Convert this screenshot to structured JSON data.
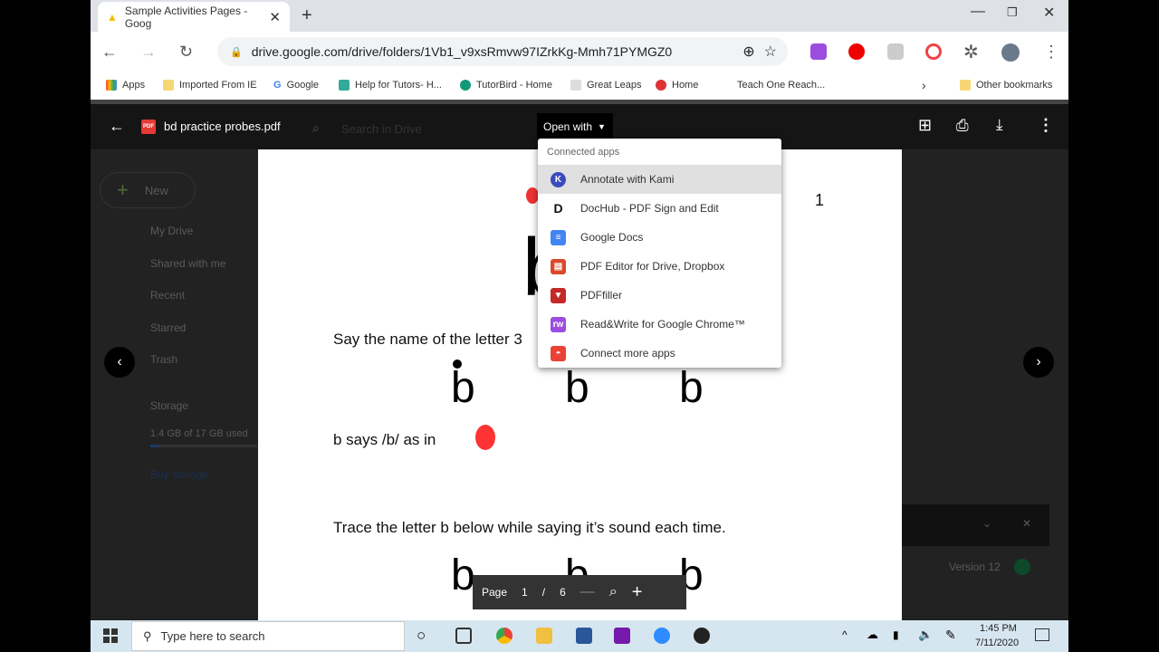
{
  "browser": {
    "tab_title": "Sample Activities Pages - Goog",
    "url": "drive.google.com/drive/folders/1Vb1_v9xsRmvw97IZrkKg-Mmh71PYMGZ0"
  },
  "bookmarks": [
    "Apps",
    "Imported From IE",
    "Google",
    "Help for Tutors- H...",
    "TutorBird - Home",
    "Great Leaps",
    "Home",
    "Teach One Reach...",
    "Other bookmarks"
  ],
  "drive": {
    "new_label": "New",
    "nav": [
      "My Drive",
      "Shared with me",
      "Recent",
      "Starred",
      "Trash"
    ],
    "storage_label": "Storage",
    "storage_used": "1.4 GB of 17 GB used",
    "storage_fraction": 0.08,
    "buy_storage": "Buy storage",
    "search_placeholder": "Search in Drive",
    "version": "Version 12"
  },
  "viewer": {
    "file_name": "bd practice probes.pdf",
    "open_with": "Open with",
    "page_label": "Page",
    "page_current": "1",
    "page_sep": "/",
    "page_total": "6"
  },
  "menu": {
    "header": "Connected apps",
    "items": [
      {
        "label": "Annotate with Kami",
        "icon": "kami-icon",
        "color": "#3b4bbd"
      },
      {
        "label": "DocHub - PDF Sign and Edit",
        "icon": "dochub-icon",
        "color": "#111111"
      },
      {
        "label": "Google Docs",
        "icon": "google-docs-icon",
        "color": "#4285f4"
      },
      {
        "label": "PDF Editor for Drive, Dropbox",
        "icon": "pdf-editor-icon",
        "color": "#d84a2c"
      },
      {
        "label": "PDFfiller",
        "icon": "pdffiller-icon",
        "color": "#c62828"
      },
      {
        "label": "Read&Write for Google Chrome™",
        "icon": "readwrite-icon",
        "color": "#9c4dde"
      },
      {
        "label": "Connect more apps",
        "icon": "marketplace-icon",
        "color": "#ea4335"
      }
    ]
  },
  "pdf": {
    "page_number": "1",
    "line1": "Say the name of the letter 3",
    "line2": "b says /b/ as in",
    "line3": "Trace the letter b below while saying it’s sound each time.",
    "letter": "b"
  },
  "taskbar": {
    "search_placeholder": "Type here to search",
    "time": "1:45 PM",
    "date": "7/11/2020"
  }
}
